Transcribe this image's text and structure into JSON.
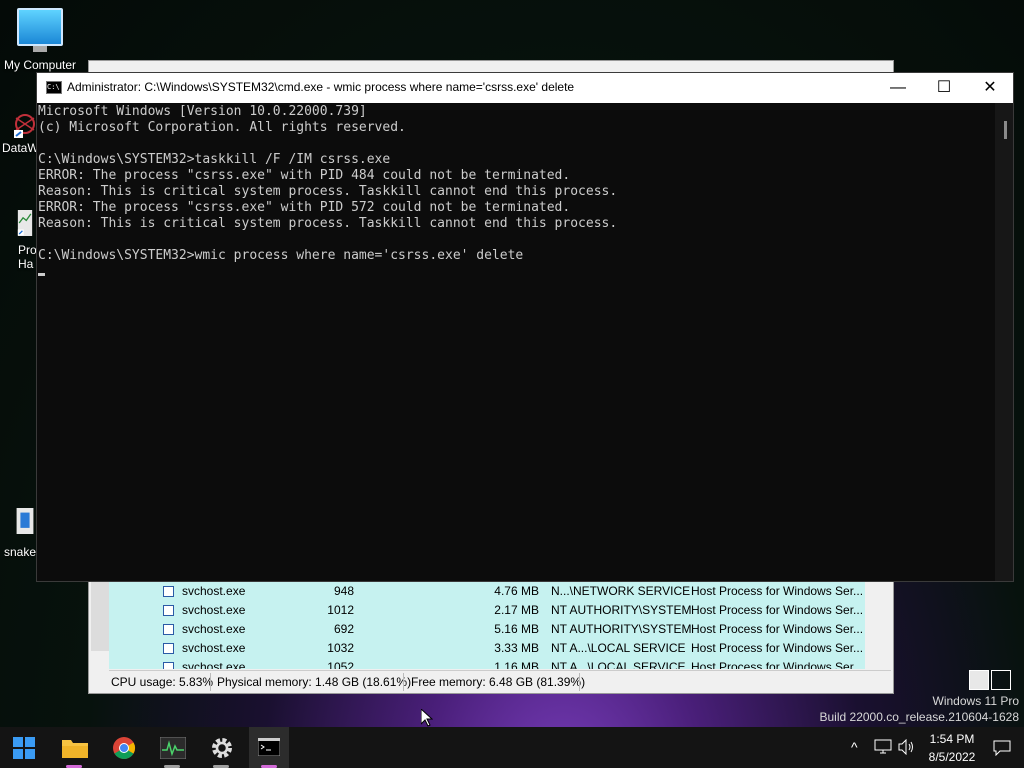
{
  "desktop": {
    "icons": [
      {
        "label": "My Computer"
      },
      {
        "label": "DataW"
      },
      {
        "label": "Pro Ha"
      },
      {
        "label": "snake"
      }
    ]
  },
  "process_hacker": {
    "rows": [
      {
        "name": "svchost.exe",
        "pid": "948",
        "mem": "4.76 MB",
        "user": "N...\\NETWORK SERVICE",
        "desc": "Host Process for Windows Ser..."
      },
      {
        "name": "svchost.exe",
        "pid": "1012",
        "mem": "2.17 MB",
        "user": "NT AUTHORITY\\SYSTEM",
        "desc": "Host Process for Windows Ser..."
      },
      {
        "name": "svchost.exe",
        "pid": "692",
        "mem": "5.16 MB",
        "user": "NT AUTHORITY\\SYSTEM",
        "desc": "Host Process for Windows Ser..."
      },
      {
        "name": "svchost.exe",
        "pid": "1032",
        "mem": "3.33 MB",
        "user": "NT A...\\LOCAL SERVICE",
        "desc": "Host Process for Windows Ser..."
      },
      {
        "name": "svchost.exe",
        "pid": "1052",
        "mem": "1.16 MB",
        "user": "NT A...\\LOCAL SERVICE",
        "desc": "Host Process for Windows Ser..."
      }
    ],
    "status": {
      "cpu": "CPU usage: 5.83%",
      "physical": "Physical memory: 1.48 GB (18.61%)",
      "free": "Free memory: 6.48 GB (81.39%)"
    }
  },
  "cmd": {
    "title": "Administrator: C:\\Windows\\SYSTEM32\\cmd.exe - wmic  process where name='csrss.exe' delete",
    "minimize": "—",
    "maximize": "☐",
    "close": "✕",
    "lines": [
      "Microsoft Windows [Version 10.0.22000.739]",
      "(c) Microsoft Corporation. All rights reserved.",
      "",
      "C:\\Windows\\SYSTEM32>taskkill /F /IM csrss.exe",
      "ERROR: The process \"csrss.exe\" with PID 484 could not be terminated.",
      "Reason: This is critical system process. Taskkill cannot end this process.",
      "ERROR: The process \"csrss.exe\" with PID 572 could not be terminated.",
      "Reason: This is critical system process. Taskkill cannot end this process.",
      "",
      "C:\\Windows\\SYSTEM32>wmic process where name='csrss.exe' delete"
    ]
  },
  "watermark": {
    "line1": "Windows 11 Pro",
    "line2": "Build 22000.co_release.210604-1628"
  },
  "taskbar": {
    "items": [
      {
        "name": "start-button",
        "icon": "windows-logo-icon"
      },
      {
        "name": "file-explorer-button",
        "icon": "folder-icon"
      },
      {
        "name": "chrome-button",
        "icon": "chrome-icon"
      },
      {
        "name": "process-hacker-button",
        "icon": "activity-icon"
      },
      {
        "name": "settings-button",
        "icon": "gear-icon"
      },
      {
        "name": "cmd-button",
        "icon": "terminal-icon"
      }
    ],
    "clock": {
      "time": "1:54 PM",
      "date": "8/5/2022"
    }
  }
}
